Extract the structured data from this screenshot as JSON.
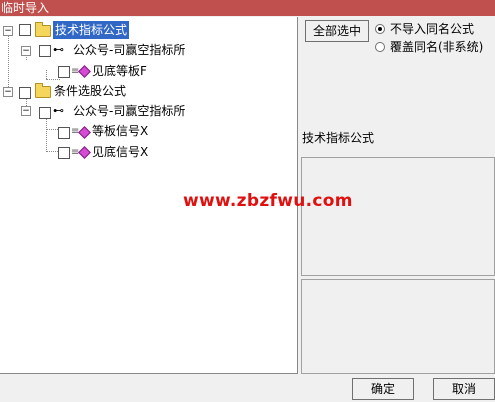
{
  "window": {
    "title": "临时导入"
  },
  "tree": {
    "nodes": [
      {
        "label": "技术指标公式",
        "expander": "−"
      },
      {
        "label": "公众号-司赢空指标所",
        "expander": "−"
      },
      {
        "label": "见底等板F"
      },
      {
        "label": "条件选股公式",
        "expander": "−"
      },
      {
        "label": "公众号-司赢空指标所",
        "expander": "−"
      },
      {
        "label": "等板信号X"
      },
      {
        "label": "见底信号X"
      }
    ]
  },
  "controls": {
    "select_all_label": "全部选中",
    "radio_no_import": "不导入同名公式",
    "radio_overwrite": "覆盖同名(非系统)"
  },
  "panel": {
    "title": "技术指标公式"
  },
  "watermark": "www.zbzfwu.com",
  "footer": {
    "ok_label": "确定",
    "cancel_label": "取消"
  },
  "colors": {
    "title_bar": "#c0504d",
    "selection": "#3168c6",
    "watermark": "#e01010",
    "item_icon": "#d64ad6",
    "folder": "#f4d65a"
  },
  "icons": {
    "folder": "folder-icon",
    "group": "key-icon",
    "item": "diamond-icon"
  }
}
